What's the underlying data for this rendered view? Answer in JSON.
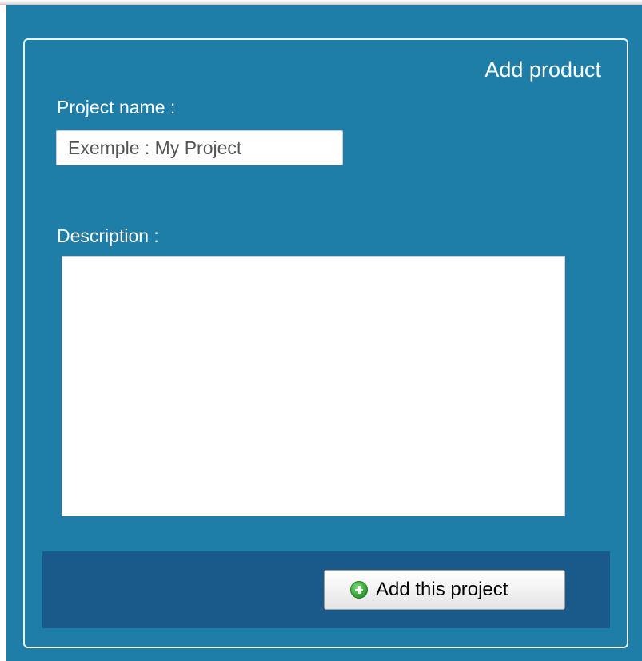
{
  "panel": {
    "title": "Add product"
  },
  "form": {
    "project_name_label": "Project name :",
    "project_name_value": "",
    "project_name_placeholder": "Exemple : My Project",
    "description_label": "Description :",
    "description_value": ""
  },
  "footer": {
    "add_button_label": "Add this project",
    "add_button_icon": "plus-circle-icon"
  },
  "colors": {
    "panel_background": "#1e7ea8",
    "footer_background": "#1a5a8a",
    "label_text": "#ffffff"
  }
}
